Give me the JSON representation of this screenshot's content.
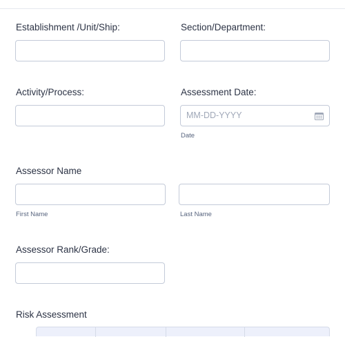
{
  "form": {
    "establishment_label": "Establishment /Unit/Ship:",
    "section_label": "Section/Department:",
    "activity_label": "Activity/Process:",
    "assessment_date_label": "Assessment Date:",
    "assessment_date_placeholder": "MM-DD-YYYY",
    "assessment_date_sublabel": "Date",
    "assessor_name_label": "Assessor Name",
    "first_name_sublabel": "First Name",
    "last_name_sublabel": "Last Name",
    "assessor_rank_label": "Assessor Rank/Grade:",
    "risk_assessment_label": "Risk Assessment"
  },
  "colors": {
    "border": "#c3cad8",
    "text": "#2c3345",
    "placeholder": "#a0a8b8",
    "table_header_bg": "#edf0fb"
  }
}
